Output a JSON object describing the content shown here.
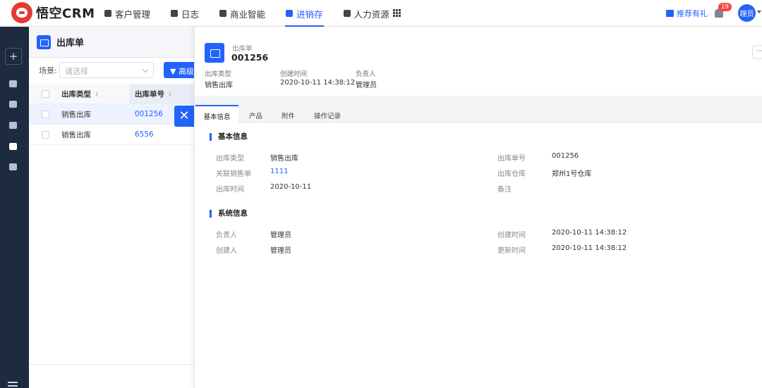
{
  "app": {
    "logo_text": "悟空CRM"
  },
  "nav": {
    "items": [
      {
        "label": "客户管理",
        "icon": "customer-icon"
      },
      {
        "label": "日志",
        "icon": "log-icon"
      },
      {
        "label": "商业智能",
        "icon": "bi-icon"
      },
      {
        "label": "进销存",
        "icon": "inventory-icon",
        "active": true
      },
      {
        "label": "人力资源",
        "icon": "hr-icon"
      }
    ],
    "apps_icon": "grid-icon",
    "gift_label": "推荐有礼",
    "notification_count": "19",
    "avatar_text": "理员"
  },
  "sidebar": {
    "add_label": "+",
    "icons": [
      "cart-icon",
      "box-icon",
      "tag-icon",
      "archive-icon",
      "report-icon"
    ]
  },
  "list": {
    "title": "出库单",
    "scene_label": "场景:",
    "scene_placeholder": "请选择",
    "advanced_label": "高级",
    "columns": [
      "出库类型",
      "出库单号"
    ],
    "rows": [
      {
        "type": "销售出库",
        "number": "001256"
      },
      {
        "type": "销售出库",
        "number": "6556"
      }
    ]
  },
  "detail": {
    "type_label": "出库单",
    "number": "001256",
    "more_label": "···",
    "summary": [
      {
        "label": "出库类型",
        "value": "销售出库"
      },
      {
        "label": "创建时间",
        "value": "2020-10-11 14:38:12"
      },
      {
        "label": "负责人",
        "value": "管理员"
      }
    ],
    "tabs": [
      "基本信息",
      "产品",
      "附件",
      "操作记录"
    ],
    "basic_title": "基本信息",
    "basic_fields": [
      {
        "label": "出库类型",
        "value": "销售出库"
      },
      {
        "label": "出库单号",
        "value": "001256"
      },
      {
        "label": "关联销售单",
        "value": "1111"
      },
      {
        "label": "出库仓库",
        "value": "郑州1号仓库"
      },
      {
        "label": "出库时间",
        "value": "2020-10-11"
      },
      {
        "label": "备注",
        "value": ""
      }
    ],
    "system_title": "系统信息",
    "system_fields": [
      {
        "label": "负责人",
        "value": "管理员"
      },
      {
        "label": "创建时间",
        "value": "2020-10-11 14:38:12"
      },
      {
        "label": "创建人",
        "value": "管理员"
      },
      {
        "label": "更新时间",
        "value": "2020-10-11 14:38:12"
      }
    ]
  },
  "colors": {
    "accent": "#2362fb",
    "sidebar": "#1e2a3f",
    "logo": "#e53935",
    "badge": "#f5483b"
  }
}
